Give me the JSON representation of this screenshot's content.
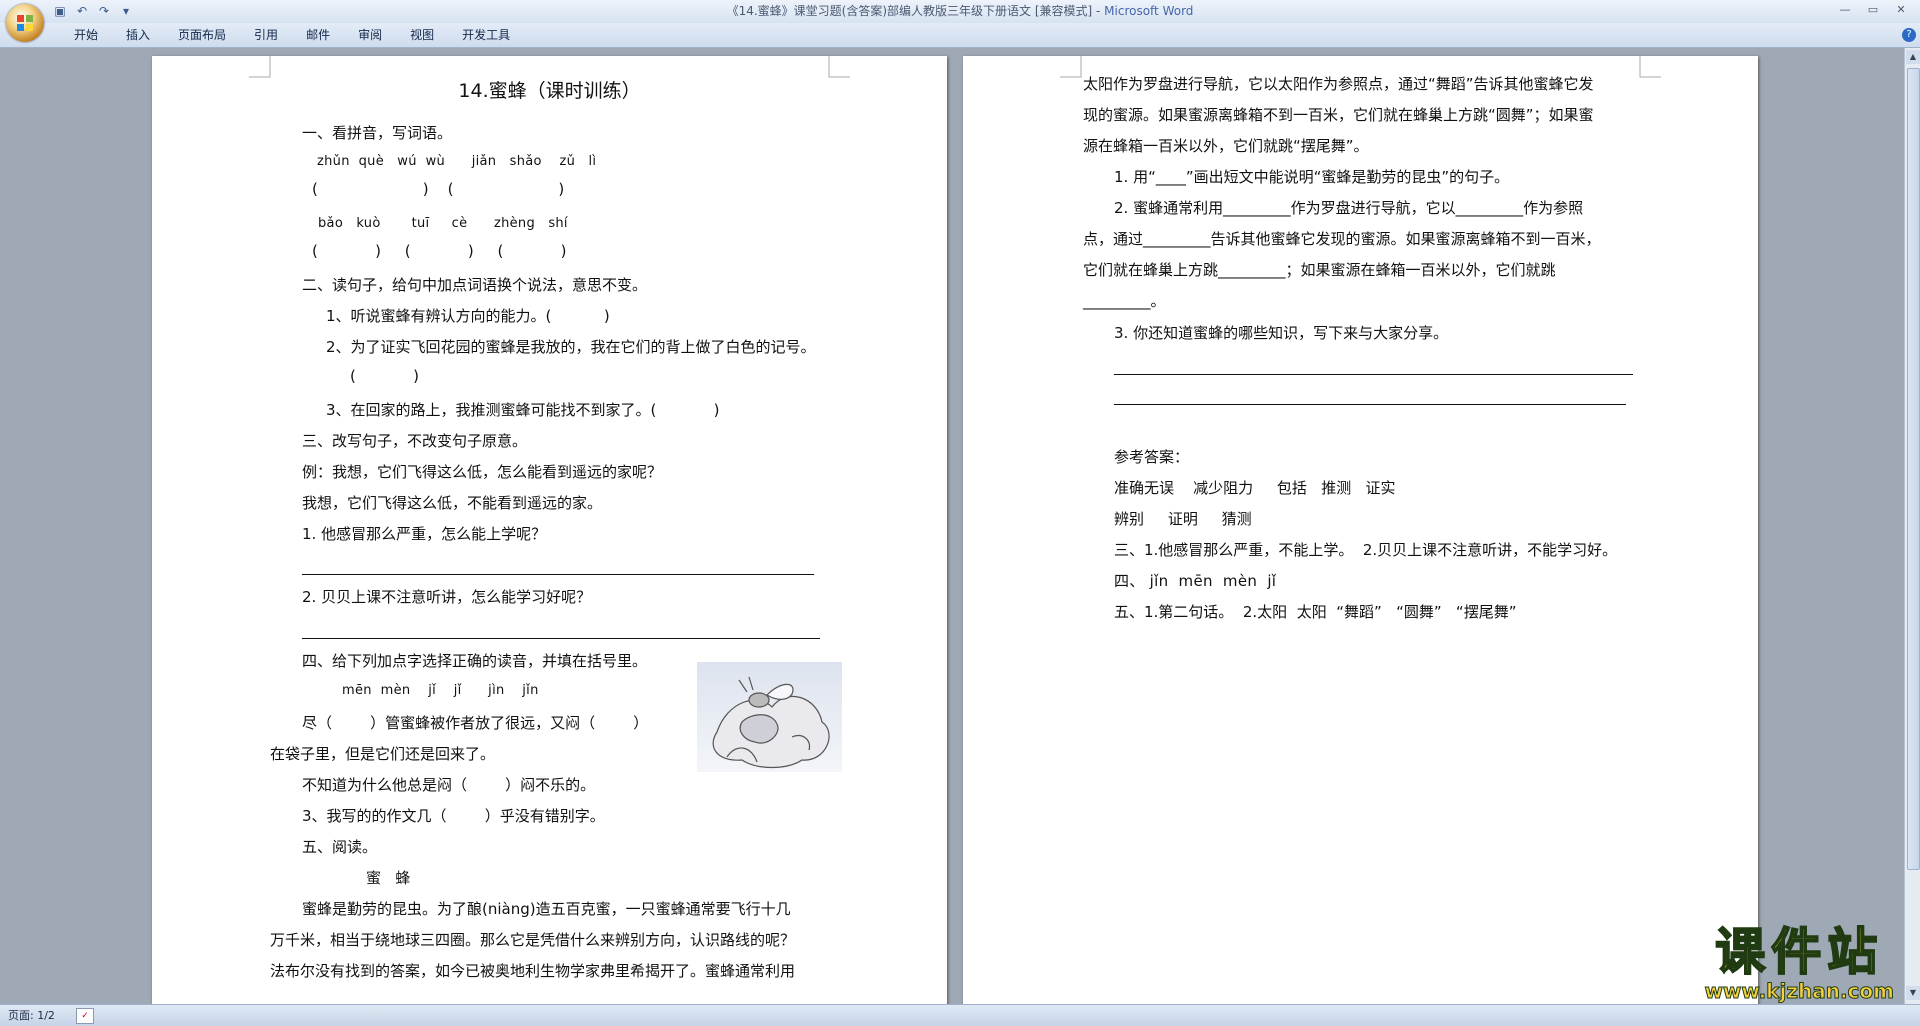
{
  "window": {
    "title_prefix": "《14.蜜蜂》课堂习题(含答案)部编人教版三年级下册语文 [兼容模式] - ",
    "title_app": "Microsoft Word"
  },
  "ribbon": {
    "tabs": [
      "开始",
      "插入",
      "页面布局",
      "引用",
      "邮件",
      "审阅",
      "视图",
      "开发工具"
    ]
  },
  "status": {
    "page": "页面: 1/2"
  },
  "watermark": {
    "big": "课件站",
    "small": "www.kjzhan.com"
  },
  "page1": {
    "title": "14.蜜蜂（课时训练）",
    "lines": [
      "一、看拼音，写词语。",
      "zhǔn  què   wú  wù      jiǎn   shǎo    zǔ   lì",
      "(                      )    (                      )",
      "bǎo   kuò       tuī     cè      zhèng   shí",
      "(            )     (            )     (            )",
      "二、读句子，给句中加点词语换个说法，意思不变。",
      "1、听说蜜蜂有辨认方向的能力。(           )",
      "2、为了证实飞回花园的蜜蜂是我放的，我在它们的背上做了白色的记号。",
      "(            )",
      "3、在回家的路上，我推测蜜蜂可能找不到家了。(            )",
      "三、改写句子，不改变句子原意。",
      "例：我想，它们飞得这么低，怎么能看到遥远的家呢？",
      "我想，它们飞得这么低，不能看到遥远的家。",
      "1. 他感冒那么严重，怎么能上学呢？",
      "2. 贝贝上课不注意听讲，怎么能学习好呢？",
      "四、给下列加点字选择正确的读音，并填在括号里。",
      "mēn  mèn    jǐ    jǐ      jìn    jǐn",
      "尽（        ）管蜜蜂被作者放了很远，又闷（        ）",
      "在袋子里，但是它们还是回来了。",
      "不知道为什么他总是闷（        ）闷不乐的。",
      "3、我写的的作文几（        ）乎没有错别字。",
      "五、阅读。",
      "蜜   蜂",
      "蜜蜂是勤劳的昆虫。为了酿(niàng)造五百克蜜，一只蜜蜂通常要飞行十几",
      "万千米，相当于绕地球三四圈。那么它是凭借什么来辨别方向，认识路线的呢？",
      "法布尔没有找到的答案，如今已被奥地利生物学家弗里希揭开了。蜜蜂通常利用"
    ]
  },
  "page2": {
    "lines": [
      "太阳作为罗盘进行导航，它以太阳作为参照点，通过“舞蹈”告诉其他蜜蜂它发",
      "现的蜜源。如果蜜源离蜂箱不到一百米，它们就在蜂巢上方跳“圆舞”；如果蜜",
      "源在蜂箱一百米以外，它们就跳“摆尾舞”。",
      "1. 用“____”画出短文中能说明“蜜蜂是勤劳的昆虫”的句子。",
      "2. 蜜蜂通常利用_________作为罗盘进行导航，它以_________作为参照",
      "点，通过_________告诉其他蜜蜂它发现的蜜源。如果蜜源离蜂箱不到一百米，",
      "它们就在蜂巢上方跳_________；如果蜜源在蜂箱一百米以外，它们就跳",
      "_________。",
      "3. 你还知道蜜蜂的哪些知识，写下来与大家分享。",
      "参考答案：",
      "准确无误    减少阻力     包括   推测   证实",
      "辨别     证明     猜测",
      "三、1.他感冒那么严重，不能上学。  2.贝贝上课不注意听讲，不能学习好。",
      "四、 jǐn  mēn  mèn  jǐ",
      "五、1.第二句话。  2.太阳  太阳  “舞蹈”   “圆舞”   “摆尾舞”"
    ]
  }
}
